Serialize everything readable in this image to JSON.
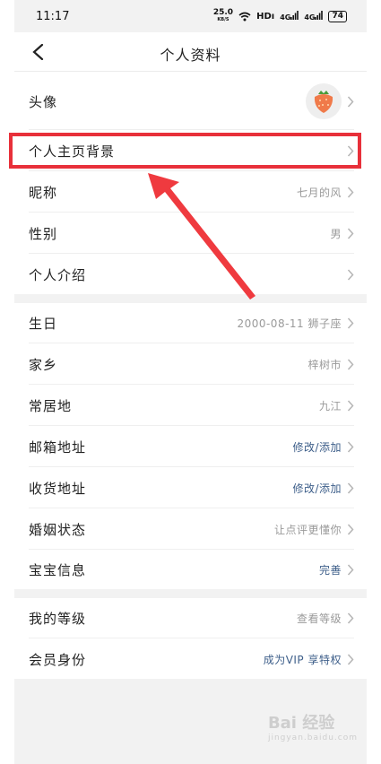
{
  "status_bar": {
    "time": "11:17",
    "net_speed": "25.0",
    "net_unit": "KB/S",
    "hd": "HDı",
    "sig1": "4G",
    "sig2": "4G",
    "battery": "74"
  },
  "nav": {
    "title": "个人资料"
  },
  "group1": [
    {
      "label": "头像",
      "value": ""
    },
    {
      "label": "个人主页背景",
      "value": ""
    },
    {
      "label": "昵称",
      "value": "七月的风"
    },
    {
      "label": "性别",
      "value": "男"
    },
    {
      "label": "个人介绍",
      "value": ""
    }
  ],
  "group2": [
    {
      "label": "生日",
      "value": "2000-08-11 狮子座"
    },
    {
      "label": "家乡",
      "value": "梓树市"
    },
    {
      "label": "常居地",
      "value": "九江"
    },
    {
      "label": "邮箱地址",
      "value": "修改/添加"
    },
    {
      "label": "收货地址",
      "value": "修改/添加"
    },
    {
      "label": "婚姻状态",
      "value": "让点评更懂你"
    },
    {
      "label": "宝宝信息",
      "value": "完善"
    }
  ],
  "group3": [
    {
      "label": "我的等级",
      "value": "查看等级"
    },
    {
      "label": "会员身份",
      "value": "成为VIP 享特权"
    }
  ],
  "watermark": {
    "brand": "Bai 经验",
    "sub": "jingyan.baidu.com"
  },
  "colors": {
    "accent_link": "#3e5f8a",
    "highlight": "#e8303a",
    "muted": "#9a9a9a"
  },
  "icons": {
    "back": "chevron-left-icon",
    "row": "chevron-right-icon",
    "avatar": "strawberry-avatar"
  }
}
